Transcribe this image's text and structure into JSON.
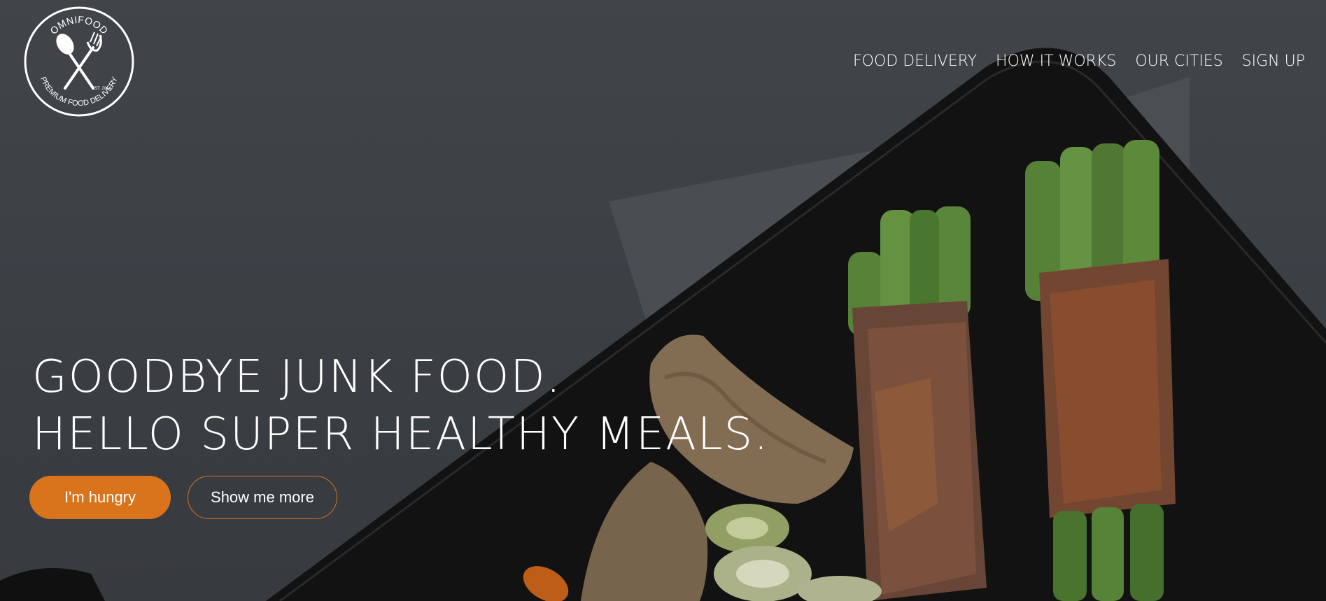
{
  "logo": {
    "top_text": "OMNIFOOD",
    "est_text": "EST. 2014",
    "bottom_text": "PREMIUM FOOD DELIVERY"
  },
  "nav": {
    "items": [
      {
        "label": "FOOD DELIVERY"
      },
      {
        "label": "HOW IT WORKS"
      },
      {
        "label": "OUR CITIES"
      },
      {
        "label": "SIGN UP"
      }
    ]
  },
  "hero": {
    "headline_line1": "GOODBYE JUNK FOOD.",
    "headline_line2": "HELLO SUPER HEALTHY MEALS.",
    "primary_button": "I'm hungry",
    "secondary_button": "Show me more"
  },
  "colors": {
    "accent": "#d9731c",
    "text": "#ffffff",
    "background": "#3e4246"
  }
}
